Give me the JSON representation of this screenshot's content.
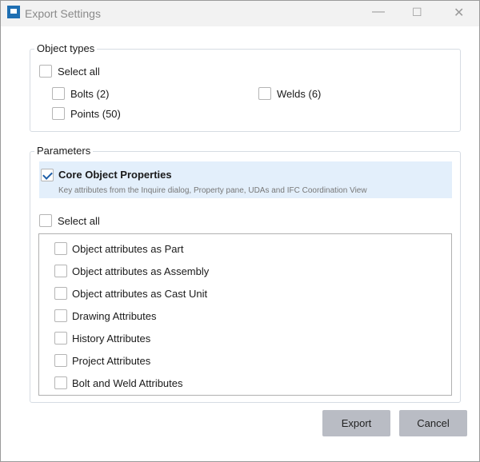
{
  "window": {
    "title": "Export Settings",
    "minimize": "—",
    "maximize": "☐",
    "close": "✕"
  },
  "object_types": {
    "label": "Object types",
    "select_all": "Select all",
    "items": [
      {
        "label": "Bolts (2)",
        "checked": false
      },
      {
        "label": "Welds (6)",
        "checked": false
      },
      {
        "label": "Points (50)",
        "checked": false
      }
    ]
  },
  "parameters": {
    "label": "Parameters",
    "core": {
      "label": "Core Object Properties",
      "description": "Key attributes from the Inquire dialog, Property pane, UDAs and IFC Coordination View",
      "checked": true
    },
    "select_all": "Select all",
    "items": [
      "Object attributes as Part",
      "Object attributes as Assembly",
      "Object attributes as Cast Unit",
      "Drawing Attributes",
      "History Attributes",
      "Project Attributes",
      "Bolt and Weld Attributes"
    ]
  },
  "buttons": {
    "export": "Export",
    "cancel": "Cancel"
  }
}
